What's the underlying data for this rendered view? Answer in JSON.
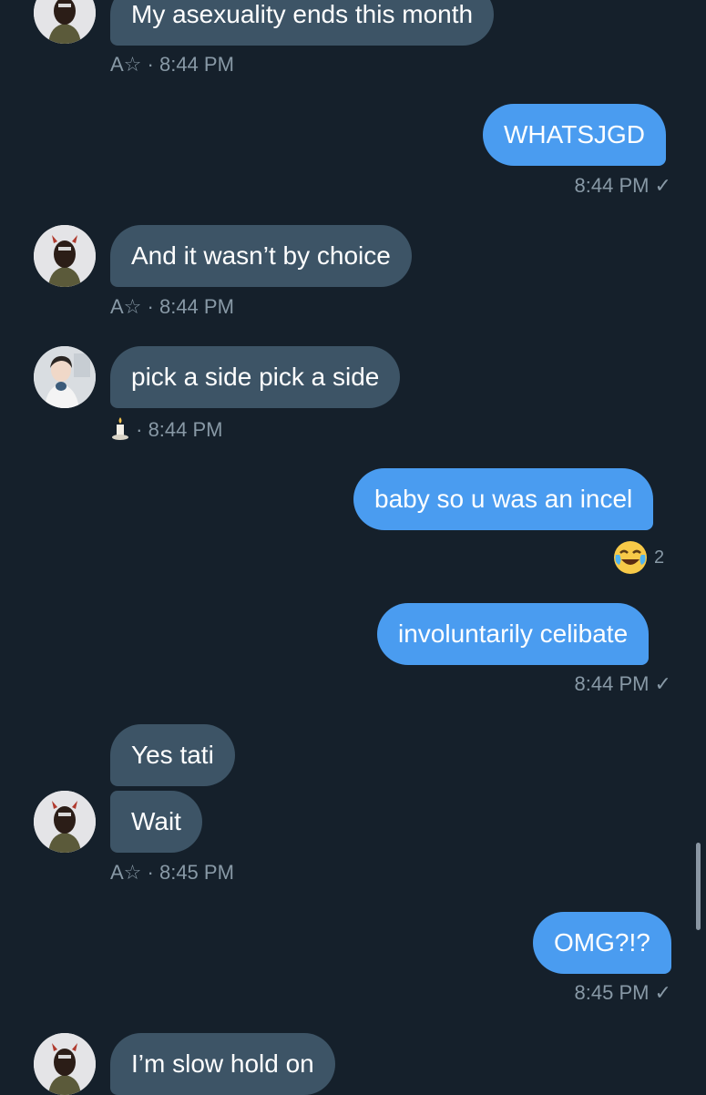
{
  "messages": [
    {
      "id": "m1",
      "text": "My asexuality ends this month",
      "meta_prefix": "A☆",
      "meta_time": "· 8:44 PM"
    },
    {
      "id": "m2",
      "text": "WHATSJGD",
      "meta_time": "8:44 PM ✓"
    },
    {
      "id": "m3",
      "text": "And it wasn’t by choice",
      "meta_prefix": "A☆",
      "meta_time": "· 8:44 PM"
    },
    {
      "id": "m4",
      "text": "pick a side pick a side",
      "meta_time": "· 8:44 PM"
    },
    {
      "id": "m5",
      "text": "baby so u was an incel",
      "reaction_emoji": "😂",
      "reaction_count": "2"
    },
    {
      "id": "m6",
      "text": "involuntarily celibate",
      "meta_time": "8:44 PM ✓"
    },
    {
      "id": "m7",
      "text": "Yes tati"
    },
    {
      "id": "m8",
      "text": "Wait",
      "meta_prefix": "A☆",
      "meta_time": "· 8:45 PM"
    },
    {
      "id": "m9",
      "text": "OMG?!?",
      "meta_time": "8:45 PM ✓"
    },
    {
      "id": "m10",
      "text": "I’m slow hold on"
    }
  ],
  "colors": {
    "background": "#15202b",
    "incoming_bubble": "#3d5466",
    "outgoing_bubble": "#4a9cf0",
    "meta_text": "#8899a6"
  }
}
